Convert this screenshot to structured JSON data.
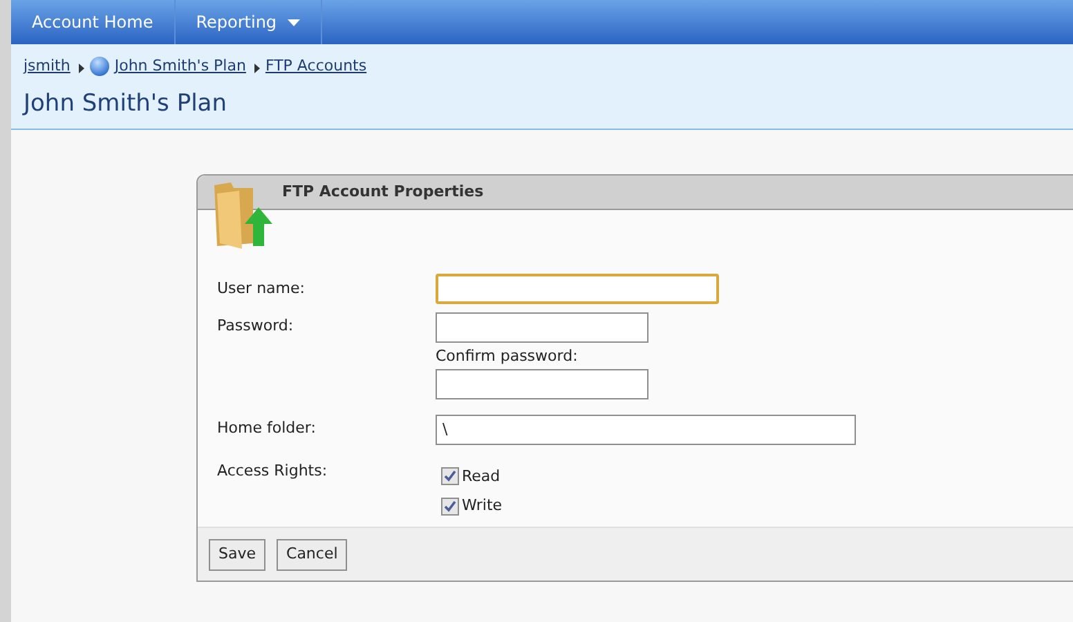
{
  "nav": {
    "items": [
      {
        "label": "Account Home",
        "has_menu": false
      },
      {
        "label": "Reporting",
        "has_menu": true
      }
    ]
  },
  "breadcrumb": [
    {
      "label": "jsmith",
      "has_icon": false
    },
    {
      "label": "John Smith's Plan",
      "has_icon": true
    },
    {
      "label": "FTP Accounts",
      "has_icon": false
    }
  ],
  "page_title": "John Smith's Plan",
  "dialog": {
    "title": "FTP Account Properties",
    "user_name": {
      "label": "User name:",
      "focused": true
    },
    "password": {
      "label": "Password:"
    },
    "confirm_password": {
      "label": "Confirm password:"
    },
    "home_folder": {
      "label": "Home folder:",
      "value": "\\"
    },
    "access_rights": {
      "label": "Access Rights:",
      "options": [
        {
          "label": "Read",
          "checked": true
        },
        {
          "label": "Write",
          "checked": true
        }
      ]
    },
    "buttons": [
      "Save",
      "Cancel"
    ]
  }
}
